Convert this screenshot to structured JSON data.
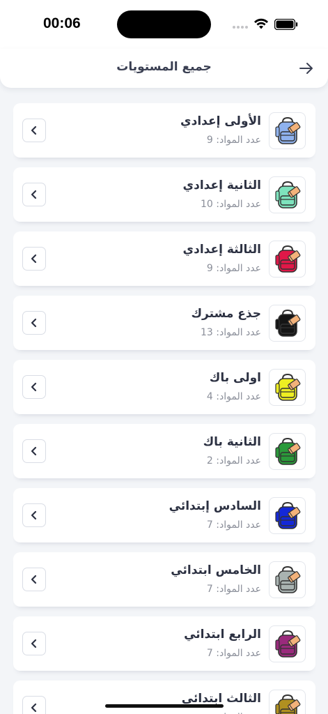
{
  "status": {
    "time": "00:06"
  },
  "header": {
    "title": "جميع المستويات"
  },
  "count_label": "عدد المواد:",
  "levels": [
    {
      "name": "الأولى إعدادي",
      "count": "9",
      "color": "#8fb2ee"
    },
    {
      "name": "الثانية إعدادي",
      "count": "10",
      "color": "#7ee3bd"
    },
    {
      "name": "الثالثة إعدادي",
      "count": "9",
      "color": "#e01848"
    },
    {
      "name": "جذع مشترك",
      "count": "13",
      "color": "#151515"
    },
    {
      "name": "اولى باك",
      "count": "4",
      "color": "#eeee22"
    },
    {
      "name": "الثانية باك",
      "count": "2",
      "color": "#2a9a3a"
    },
    {
      "name": "السادس إبتدائي",
      "count": "7",
      "color": "#1428d8"
    },
    {
      "name": "الخامس ابتدائي",
      "count": "7",
      "color": "#a9b3b1"
    },
    {
      "name": "الرابع ابتدائي",
      "count": "7",
      "color": "#9a2a7c"
    },
    {
      "name": "الثالث ابتدائي",
      "count": "",
      "color": "#b09020"
    }
  ]
}
